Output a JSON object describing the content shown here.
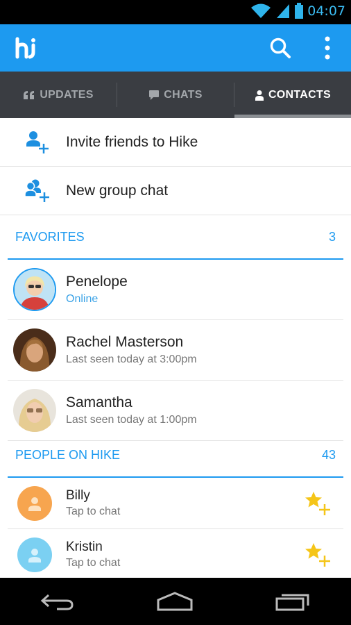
{
  "status_bar": {
    "time": "04:07"
  },
  "app": {
    "logo_text": "hi"
  },
  "tabs": [
    {
      "label": "UPDATES"
    },
    {
      "label": "CHATS"
    },
    {
      "label": "CONTACTS"
    }
  ],
  "actions": [
    {
      "label": "Invite friends to Hike"
    },
    {
      "label": "New group chat"
    }
  ],
  "favorites": {
    "title": "FAVORITES",
    "count": "3",
    "items": [
      {
        "name": "Penelope",
        "status": "Online"
      },
      {
        "name": "Rachel Masterson",
        "status": "Last seen today at 3:00pm"
      },
      {
        "name": "Samantha",
        "status": "Last seen today at 1:00pm"
      }
    ]
  },
  "people": {
    "title": "PEOPLE ON HIKE",
    "count": "43",
    "items": [
      {
        "name": "Billy",
        "status": "Tap to chat"
      },
      {
        "name": "Kristin",
        "status": "Tap to chat"
      }
    ]
  },
  "colors": {
    "accent": "#1d9af0",
    "tab_bar": "#3a3d42",
    "star": "#f5c518",
    "avatar_orange": "#f7a54f",
    "avatar_blue": "#7bd0f2"
  },
  "icons": [
    "wifi-icon",
    "signal-icon",
    "battery-icon",
    "search-icon",
    "overflow-menu-icon",
    "quote-icon",
    "chat-bubble-icon",
    "person-icon",
    "add-person-icon",
    "add-group-icon",
    "star-add-icon",
    "back-icon",
    "home-icon",
    "recent-apps-icon"
  ]
}
